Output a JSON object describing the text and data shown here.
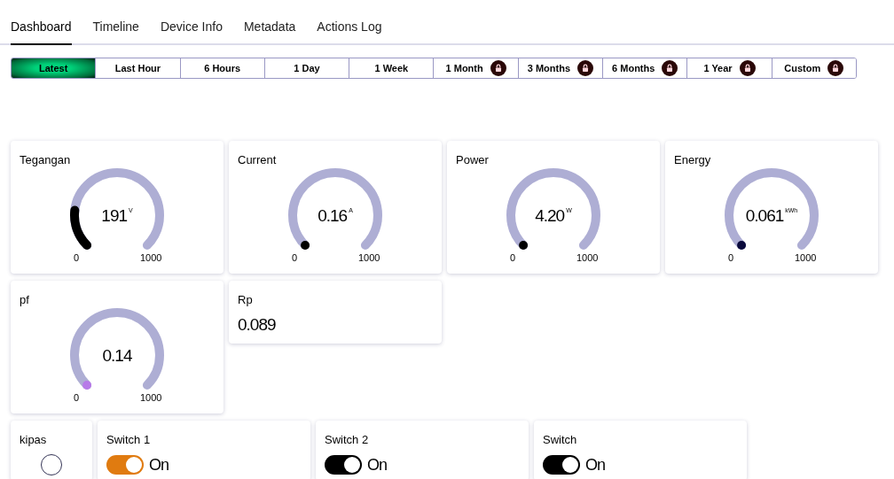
{
  "tabs": [
    {
      "label": "Dashboard",
      "selected": true
    },
    {
      "label": "Timeline",
      "selected": false
    },
    {
      "label": "Device Info",
      "selected": false
    },
    {
      "label": "Metadata",
      "selected": false
    },
    {
      "label": "Actions Log",
      "selected": false
    }
  ],
  "time_ranges": [
    {
      "label": "Latest",
      "selected": true,
      "locked": false
    },
    {
      "label": "Last Hour",
      "selected": false,
      "locked": false
    },
    {
      "label": "6 Hours",
      "selected": false,
      "locked": false
    },
    {
      "label": "1 Day",
      "selected": false,
      "locked": false
    },
    {
      "label": "1 Week",
      "selected": false,
      "locked": false
    },
    {
      "label": "1 Month",
      "selected": false,
      "locked": true
    },
    {
      "label": "3 Months",
      "selected": false,
      "locked": true
    },
    {
      "label": "6 Months",
      "selected": false,
      "locked": true
    },
    {
      "label": "1 Year",
      "selected": false,
      "locked": true
    },
    {
      "label": "Custom",
      "selected": false,
      "locked": true
    }
  ],
  "gauges": [
    {
      "title": "Tegangan",
      "value": "191",
      "unit": "V",
      "min": "0",
      "max": "1000",
      "color": "#000000"
    },
    {
      "title": "Current",
      "value": "0.16",
      "unit": "A",
      "min": "0",
      "max": "1000",
      "color": "#000000"
    },
    {
      "title": "Power",
      "value": "4.20",
      "unit": "W",
      "min": "0",
      "max": "1000",
      "color": "#000000"
    },
    {
      "title": "Energy",
      "value": "0.061",
      "unit": "kWh",
      "min": "0",
      "max": "1000",
      "color": "#0a0a3c"
    },
    {
      "title": "pf",
      "value": "0.14",
      "min": "0",
      "max": "1000",
      "color": "#b77be8"
    }
  ],
  "value_card": {
    "title": "Rp",
    "value": "0.089"
  },
  "controls": [
    {
      "kind": "indicator",
      "title": "kipas",
      "on": false
    },
    {
      "kind": "toggle",
      "title": "Switch 1",
      "on": true,
      "label": "On",
      "color": "#e07b10"
    },
    {
      "kind": "toggle",
      "title": "Switch 2",
      "on": true,
      "label": "On",
      "color": "#000000"
    },
    {
      "kind": "toggle",
      "title": "Switch",
      "on": true,
      "label": "On",
      "color": "#000000"
    }
  ]
}
